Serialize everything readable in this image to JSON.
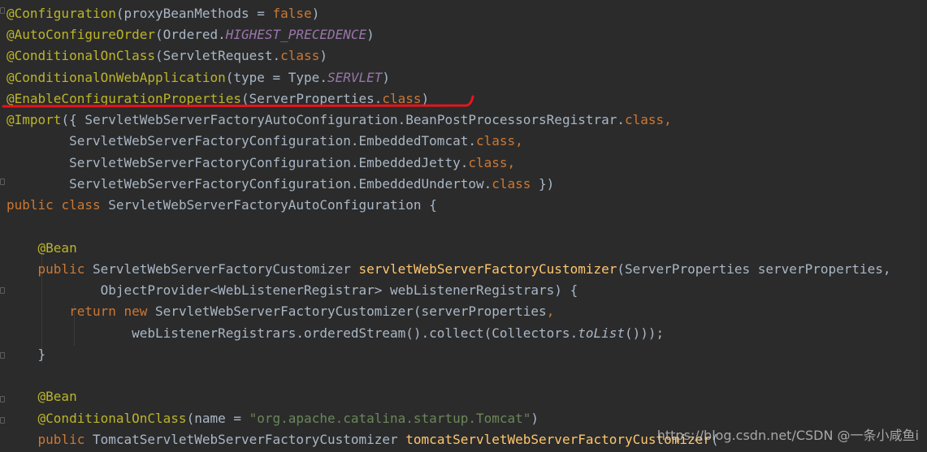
{
  "watermark": "https://blog.csdn.net/CSDN @一条小咸鱼i",
  "colors": {
    "background": "#2b2b2b",
    "annotation": "#bbb529",
    "keyword": "#cc7832",
    "method_name": "#ffc66d",
    "static_field": "#9876aa",
    "string": "#6a8759",
    "default_text": "#a9b7c6",
    "highlight_underline": "#e8141c"
  },
  "code": {
    "l1": [
      "@Configuration",
      "(proxyBeanMethods = ",
      "false",
      ")"
    ],
    "l2": [
      "@AutoConfigureOrder",
      "(Ordered.",
      "HIGHEST_PRECEDENCE",
      ")"
    ],
    "l3": [
      "@ConditionalOnClass",
      "(ServletRequest.",
      "class",
      ")"
    ],
    "l4": [
      "@ConditionalOnWebApplication",
      "(type = Type.",
      "SERVLET",
      ")"
    ],
    "l5": [
      "@EnableConfigurationProperties",
      "(ServerProperties.",
      "class",
      ")"
    ],
    "l6": [
      "@Import",
      "({ ServletWebServerFactoryAutoConfiguration.BeanPostProcessorsRegistrar.",
      "class",
      ","
    ],
    "l7": [
      "        ServletWebServerFactoryConfiguration.EmbeddedTomcat.",
      "class",
      ","
    ],
    "l8": [
      "        ServletWebServerFactoryConfiguration.EmbeddedJetty.",
      "class",
      ","
    ],
    "l9": [
      "        ServletWebServerFactoryConfiguration.EmbeddedUndertow.",
      "class",
      " })"
    ],
    "l10": [
      "public",
      " ",
      "class",
      " ServletWebServerFactoryAutoConfiguration {"
    ],
    "l12": [
      "    ",
      "@Bean"
    ],
    "l13": [
      "    ",
      "public",
      " ServletWebServerFactoryCustomizer ",
      "servletWebServerFactoryCustomizer",
      "(ServerProperties serverProperties,"
    ],
    "l14": [
      "            ObjectProvider<WebListenerRegistrar> webListenerRegistrars) {"
    ],
    "l15": [
      "        ",
      "return",
      " ",
      "new",
      " ServletWebServerFactoryCustomizer(serverProperties",
      ","
    ],
    "l16": [
      "                webListenerRegistrars.orderedStream().collect(Collectors.",
      "toList",
      "()));"
    ],
    "l17": [
      "    }"
    ],
    "l19": [
      "    ",
      "@Bean"
    ],
    "l20": [
      "    ",
      "@ConditionalOnClass",
      "(name = ",
      "\"org.apache.catalina.startup.Tomcat\"",
      ")"
    ],
    "l21": [
      "    ",
      "public",
      " TomcatServletWebServerFactoryCustomizer ",
      "tomcatServletWebServerFactoryCustomizer",
      "("
    ]
  }
}
